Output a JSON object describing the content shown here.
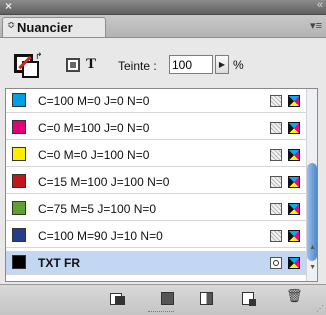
{
  "window": {
    "close_glyph": "×",
    "collapse_glyph": "«"
  },
  "tab": {
    "arrows_glyph": "≎",
    "label": "Nuancier",
    "menu_glyph": "▾≡"
  },
  "toolbar": {
    "text_glyph": "T",
    "swap_glyph": "↱",
    "teinte_label": "Teinte :",
    "teinte_value": "100",
    "stepper_glyph": "▶",
    "percent_label": "%"
  },
  "swatches": [
    {
      "name": "C=100 M=0 J=0 N=0",
      "color": "#009fe3",
      "kind": "process",
      "selected": false
    },
    {
      "name": "C=0 M=100 J=0 N=0",
      "color": "#e3007b",
      "kind": "process",
      "selected": false
    },
    {
      "name": "C=0 M=0 J=100 N=0",
      "color": "#ffed00",
      "kind": "process",
      "selected": false
    },
    {
      "name": "C=15 M=100 J=100 N=0",
      "color": "#c3161c",
      "kind": "process",
      "selected": false
    },
    {
      "name": "C=75 M=5 J=100 N=0",
      "color": "#5ea12f",
      "kind": "process",
      "selected": false
    },
    {
      "name": "C=100 M=90 J=10 N=0",
      "color": "#263c8d",
      "kind": "process",
      "selected": false
    },
    {
      "name": "TXT FR",
      "color": "#000000",
      "kind": "spot",
      "selected": true
    }
  ],
  "scroll": {
    "up_glyph": "▲",
    "down_glyph": "▼"
  },
  "bottom": {
    "trash_glyph": "🗑",
    "resize_glyph": "⋰"
  }
}
